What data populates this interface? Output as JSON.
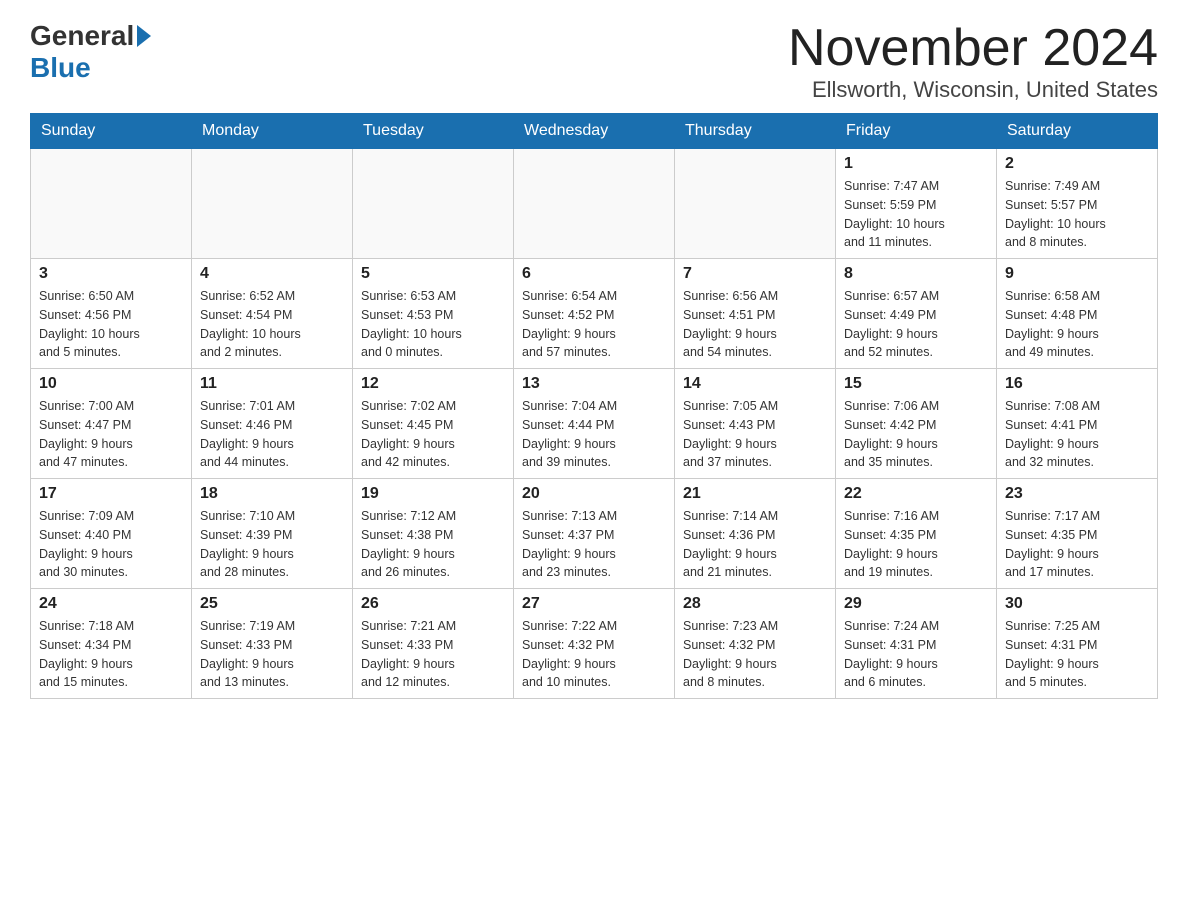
{
  "header": {
    "logo_general": "General",
    "logo_blue": "Blue",
    "title": "November 2024",
    "subtitle": "Ellsworth, Wisconsin, United States"
  },
  "weekdays": [
    "Sunday",
    "Monday",
    "Tuesday",
    "Wednesday",
    "Thursday",
    "Friday",
    "Saturday"
  ],
  "weeks": [
    [
      {
        "day": "",
        "info": ""
      },
      {
        "day": "",
        "info": ""
      },
      {
        "day": "",
        "info": ""
      },
      {
        "day": "",
        "info": ""
      },
      {
        "day": "",
        "info": ""
      },
      {
        "day": "1",
        "info": "Sunrise: 7:47 AM\nSunset: 5:59 PM\nDaylight: 10 hours\nand 11 minutes."
      },
      {
        "day": "2",
        "info": "Sunrise: 7:49 AM\nSunset: 5:57 PM\nDaylight: 10 hours\nand 8 minutes."
      }
    ],
    [
      {
        "day": "3",
        "info": "Sunrise: 6:50 AM\nSunset: 4:56 PM\nDaylight: 10 hours\nand 5 minutes."
      },
      {
        "day": "4",
        "info": "Sunrise: 6:52 AM\nSunset: 4:54 PM\nDaylight: 10 hours\nand 2 minutes."
      },
      {
        "day": "5",
        "info": "Sunrise: 6:53 AM\nSunset: 4:53 PM\nDaylight: 10 hours\nand 0 minutes."
      },
      {
        "day": "6",
        "info": "Sunrise: 6:54 AM\nSunset: 4:52 PM\nDaylight: 9 hours\nand 57 minutes."
      },
      {
        "day": "7",
        "info": "Sunrise: 6:56 AM\nSunset: 4:51 PM\nDaylight: 9 hours\nand 54 minutes."
      },
      {
        "day": "8",
        "info": "Sunrise: 6:57 AM\nSunset: 4:49 PM\nDaylight: 9 hours\nand 52 minutes."
      },
      {
        "day": "9",
        "info": "Sunrise: 6:58 AM\nSunset: 4:48 PM\nDaylight: 9 hours\nand 49 minutes."
      }
    ],
    [
      {
        "day": "10",
        "info": "Sunrise: 7:00 AM\nSunset: 4:47 PM\nDaylight: 9 hours\nand 47 minutes."
      },
      {
        "day": "11",
        "info": "Sunrise: 7:01 AM\nSunset: 4:46 PM\nDaylight: 9 hours\nand 44 minutes."
      },
      {
        "day": "12",
        "info": "Sunrise: 7:02 AM\nSunset: 4:45 PM\nDaylight: 9 hours\nand 42 minutes."
      },
      {
        "day": "13",
        "info": "Sunrise: 7:04 AM\nSunset: 4:44 PM\nDaylight: 9 hours\nand 39 minutes."
      },
      {
        "day": "14",
        "info": "Sunrise: 7:05 AM\nSunset: 4:43 PM\nDaylight: 9 hours\nand 37 minutes."
      },
      {
        "day": "15",
        "info": "Sunrise: 7:06 AM\nSunset: 4:42 PM\nDaylight: 9 hours\nand 35 minutes."
      },
      {
        "day": "16",
        "info": "Sunrise: 7:08 AM\nSunset: 4:41 PM\nDaylight: 9 hours\nand 32 minutes."
      }
    ],
    [
      {
        "day": "17",
        "info": "Sunrise: 7:09 AM\nSunset: 4:40 PM\nDaylight: 9 hours\nand 30 minutes."
      },
      {
        "day": "18",
        "info": "Sunrise: 7:10 AM\nSunset: 4:39 PM\nDaylight: 9 hours\nand 28 minutes."
      },
      {
        "day": "19",
        "info": "Sunrise: 7:12 AM\nSunset: 4:38 PM\nDaylight: 9 hours\nand 26 minutes."
      },
      {
        "day": "20",
        "info": "Sunrise: 7:13 AM\nSunset: 4:37 PM\nDaylight: 9 hours\nand 23 minutes."
      },
      {
        "day": "21",
        "info": "Sunrise: 7:14 AM\nSunset: 4:36 PM\nDaylight: 9 hours\nand 21 minutes."
      },
      {
        "day": "22",
        "info": "Sunrise: 7:16 AM\nSunset: 4:35 PM\nDaylight: 9 hours\nand 19 minutes."
      },
      {
        "day": "23",
        "info": "Sunrise: 7:17 AM\nSunset: 4:35 PM\nDaylight: 9 hours\nand 17 minutes."
      }
    ],
    [
      {
        "day": "24",
        "info": "Sunrise: 7:18 AM\nSunset: 4:34 PM\nDaylight: 9 hours\nand 15 minutes."
      },
      {
        "day": "25",
        "info": "Sunrise: 7:19 AM\nSunset: 4:33 PM\nDaylight: 9 hours\nand 13 minutes."
      },
      {
        "day": "26",
        "info": "Sunrise: 7:21 AM\nSunset: 4:33 PM\nDaylight: 9 hours\nand 12 minutes."
      },
      {
        "day": "27",
        "info": "Sunrise: 7:22 AM\nSunset: 4:32 PM\nDaylight: 9 hours\nand 10 minutes."
      },
      {
        "day": "28",
        "info": "Sunrise: 7:23 AM\nSunset: 4:32 PM\nDaylight: 9 hours\nand 8 minutes."
      },
      {
        "day": "29",
        "info": "Sunrise: 7:24 AM\nSunset: 4:31 PM\nDaylight: 9 hours\nand 6 minutes."
      },
      {
        "day": "30",
        "info": "Sunrise: 7:25 AM\nSunset: 4:31 PM\nDaylight: 9 hours\nand 5 minutes."
      }
    ]
  ]
}
